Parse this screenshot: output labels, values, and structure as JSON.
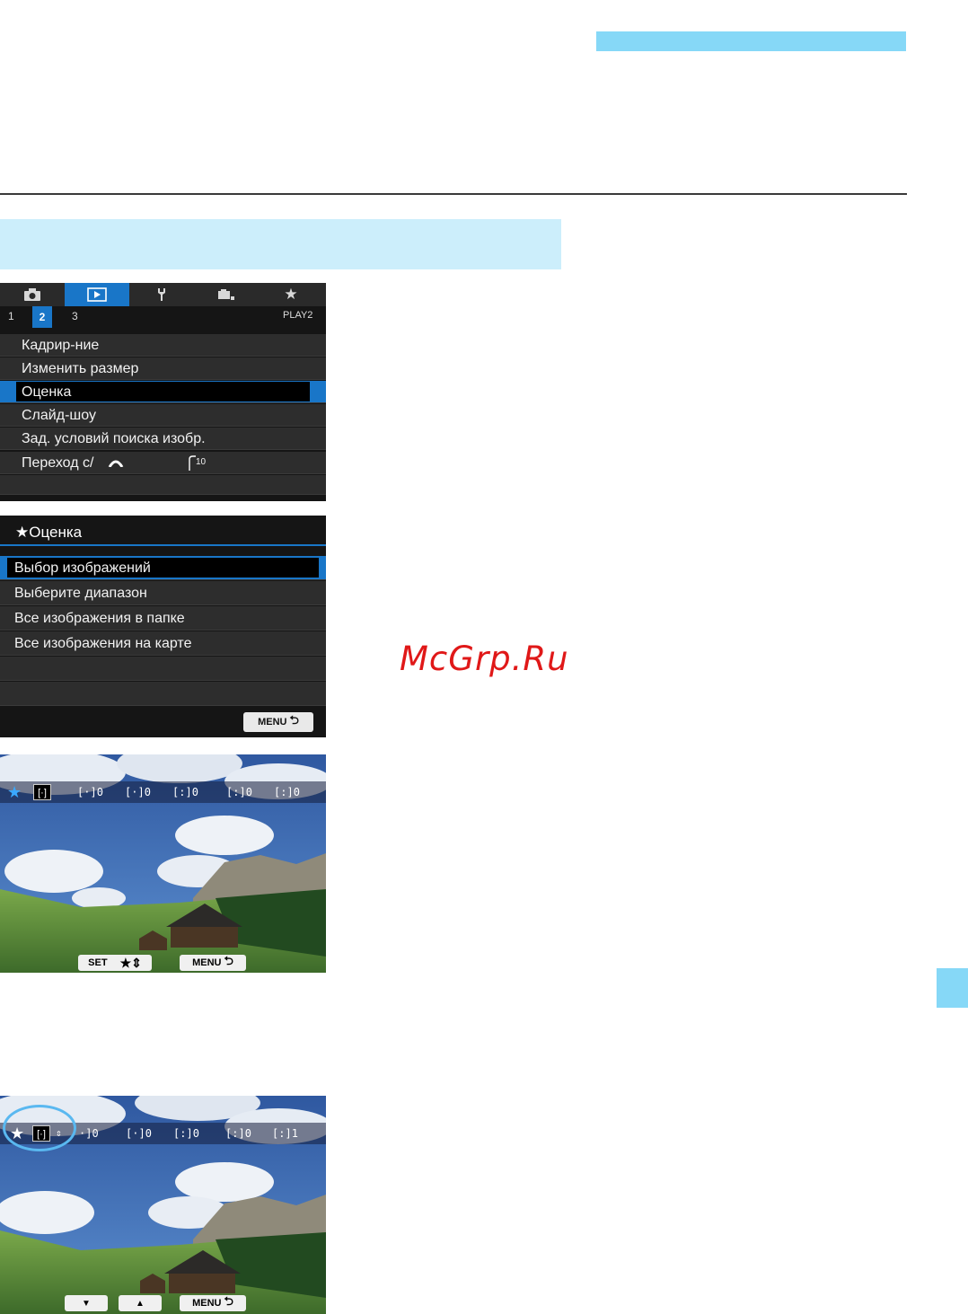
{
  "watermark": "McGrp.Ru",
  "screen1": {
    "tabs": [
      "camera-icon",
      "play-icon",
      "wrench-icon",
      "custom-icon",
      "star-icon"
    ],
    "subtabs": [
      "1",
      "2",
      "3"
    ],
    "page_label": "PLAY2",
    "items": [
      {
        "label": "Кадрир-ние"
      },
      {
        "label": "Изменить размер"
      },
      {
        "label": "Оценка"
      },
      {
        "label": "Слайд-шоу"
      },
      {
        "label": "Зад. условий поиска изобр."
      },
      {
        "label": "Переход с/",
        "suffix": "10"
      }
    ]
  },
  "screen2": {
    "title": "★Оценка",
    "items": [
      {
        "label": "Выбор изображений"
      },
      {
        "label": "Выберите диапазон"
      },
      {
        "label": "Все изображения в папке"
      },
      {
        "label": "Все изображения на карте"
      }
    ],
    "menu_label": "MENU"
  },
  "photo1": {
    "counts": [
      "0",
      "0",
      "0",
      "0",
      "0"
    ],
    "set_label": "SET",
    "menu_label": "MENU"
  },
  "photo2": {
    "counts": [
      "0",
      "0",
      "0",
      "0",
      "1"
    ],
    "menu_label": "MENU"
  },
  "colors": {
    "accent": "#86d8f7",
    "light": "#cceefb",
    "menu_select": "#1976c8",
    "watermark": "#e01818"
  }
}
